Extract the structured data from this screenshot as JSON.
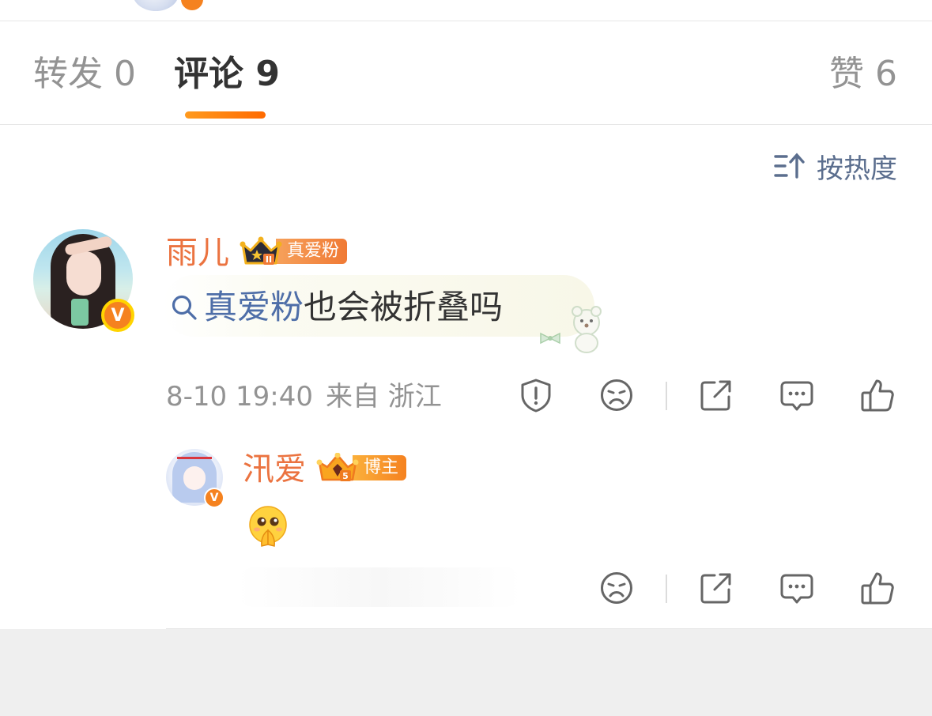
{
  "tabs": [
    {
      "label": "转发",
      "count": "0"
    },
    {
      "label": "评论",
      "count": "9"
    },
    {
      "label": "赞",
      "count": "6"
    }
  ],
  "active_tab": "评论",
  "sort": {
    "label": "按热度",
    "icon": "sort-hot-icon"
  },
  "comment": {
    "username": "雨儿",
    "badge_label": "真爱粉",
    "badge_level": "II",
    "text_link": "真爱粉",
    "text_rest": "也会被折叠吗",
    "date": "8-10 19:40",
    "source": "来自 浙江",
    "actions": [
      "report-icon",
      "dislike-icon",
      "share-icon",
      "reply-icon",
      "like-icon"
    ]
  },
  "reply": {
    "username": "汛爱",
    "badge_label": "博主",
    "badge_level": "5",
    "content_emoji": "pray-emoji",
    "actions": [
      "dislike-icon",
      "share-icon",
      "reply-icon",
      "like-icon"
    ]
  },
  "colors": {
    "accent": "#ff7a00",
    "username": "#eb7340",
    "link": "#4e6ea8",
    "muted": "#939393",
    "verified": "#f5821f"
  }
}
